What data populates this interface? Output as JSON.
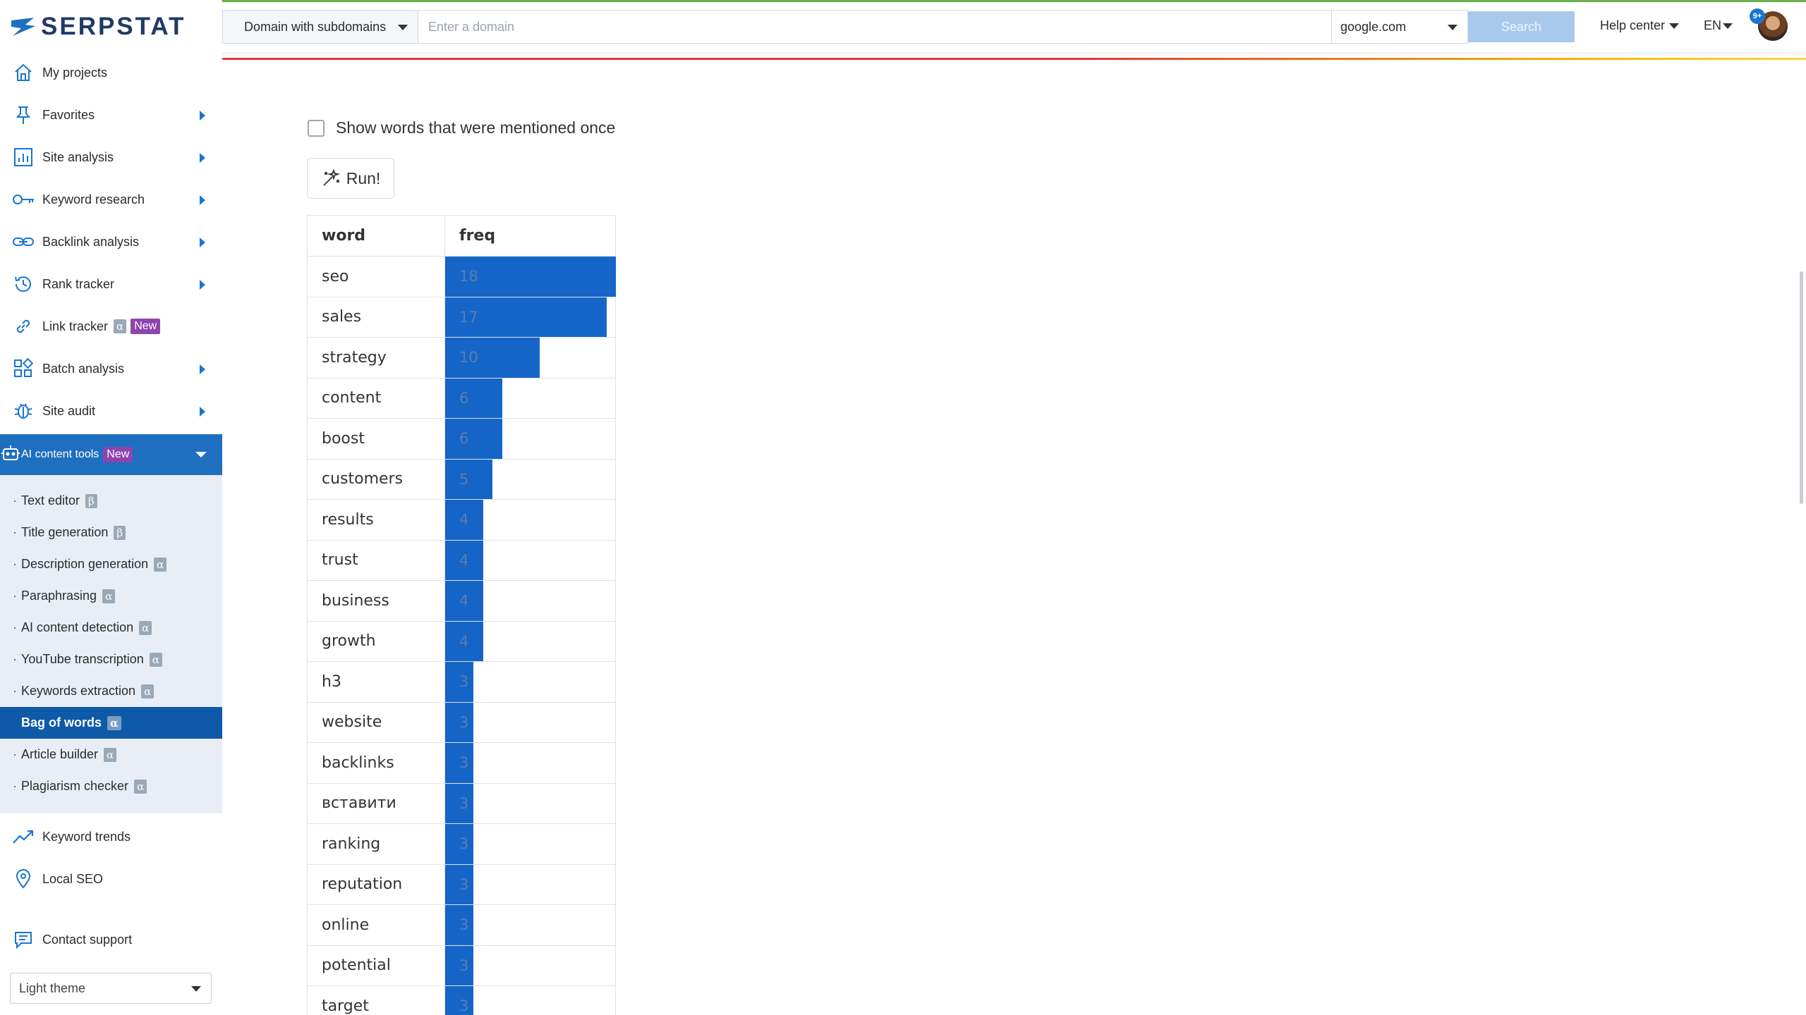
{
  "brand": {
    "name": "SERPSTAT"
  },
  "sidebar": {
    "items": [
      {
        "label": "My projects",
        "icon": "home-icon",
        "arrow": false,
        "badge": null
      },
      {
        "label": "Favorites",
        "icon": "pin-icon",
        "arrow": true,
        "badge": null
      },
      {
        "label": "Site analysis",
        "icon": "chart-icon",
        "arrow": true,
        "badge": null
      },
      {
        "label": "Keyword research",
        "icon": "key-icon",
        "arrow": true,
        "badge": null
      },
      {
        "label": "Backlink analysis",
        "icon": "link-icon",
        "arrow": true,
        "badge": null
      },
      {
        "label": "Rank tracker",
        "icon": "history-icon",
        "arrow": true,
        "badge": null
      },
      {
        "label": "Link tracker",
        "icon": "chain-icon",
        "arrow": false,
        "badge": "α",
        "badge2": "New"
      },
      {
        "label": "Batch analysis",
        "icon": "grid-icon",
        "arrow": true,
        "badge": null
      },
      {
        "label": "Site audit",
        "icon": "bug-icon",
        "arrow": true,
        "badge": null
      }
    ],
    "ai_tools": {
      "label": "AI content tools",
      "badge": "New",
      "icon": "robot-icon",
      "sub_items": [
        {
          "label": "Text editor",
          "badge": "β",
          "active": false
        },
        {
          "label": "Title generation",
          "badge": "β",
          "active": false
        },
        {
          "label": "Description generation",
          "badge": "α",
          "active": false
        },
        {
          "label": "Paraphrasing",
          "badge": "α",
          "active": false
        },
        {
          "label": "AI content detection",
          "badge": "α",
          "active": false
        },
        {
          "label": "YouTube transcription",
          "badge": "α",
          "active": false
        },
        {
          "label": "Keywords extraction",
          "badge": "α",
          "active": false
        },
        {
          "label": "Bag of words",
          "badge": "α",
          "active": true
        },
        {
          "label": "Article builder",
          "badge": "α",
          "active": false
        },
        {
          "label": "Plagiarism checker",
          "badge": "α",
          "active": false
        }
      ]
    },
    "bottom_items": [
      {
        "label": "Keyword trends",
        "icon": "trend-icon"
      },
      {
        "label": "Local SEO",
        "icon": "location-icon"
      }
    ],
    "contact_support": "Contact support",
    "theme": "Light theme"
  },
  "topbar": {
    "domain_type": "Domain with subdomains",
    "domain_placeholder": "Enter a domain",
    "search_engine": "google.com",
    "search_label": "Search",
    "help_center": "Help center",
    "language": "EN",
    "notifications": "9+"
  },
  "main": {
    "show_once_label": "Show words that were mentioned once",
    "show_once_checked": false,
    "run_label": "Run!",
    "table": {
      "headers": [
        "word",
        "freq"
      ],
      "max_freq": 18,
      "rows": [
        {
          "word": "seo",
          "freq": 18
        },
        {
          "word": "sales",
          "freq": 17
        },
        {
          "word": "strategy",
          "freq": 10
        },
        {
          "word": "content",
          "freq": 6
        },
        {
          "word": "boost",
          "freq": 6
        },
        {
          "word": "customers",
          "freq": 5
        },
        {
          "word": "results",
          "freq": 4
        },
        {
          "word": "trust",
          "freq": 4
        },
        {
          "word": "business",
          "freq": 4
        },
        {
          "word": "growth",
          "freq": 4
        },
        {
          "word": "h3",
          "freq": 3
        },
        {
          "word": "website",
          "freq": 3
        },
        {
          "word": "backlinks",
          "freq": 3
        },
        {
          "word": "вставити",
          "freq": 3
        },
        {
          "word": "ranking",
          "freq": 3
        },
        {
          "word": "reputation",
          "freq": 3
        },
        {
          "word": "online",
          "freq": 3
        },
        {
          "word": "potential",
          "freq": 3
        },
        {
          "word": "target",
          "freq": 3
        }
      ]
    }
  },
  "colors": {
    "accent": "#1976d2",
    "bar": "#1565c8",
    "active_nav": "#1f6fc0",
    "new_badge": "#8e44ad"
  }
}
